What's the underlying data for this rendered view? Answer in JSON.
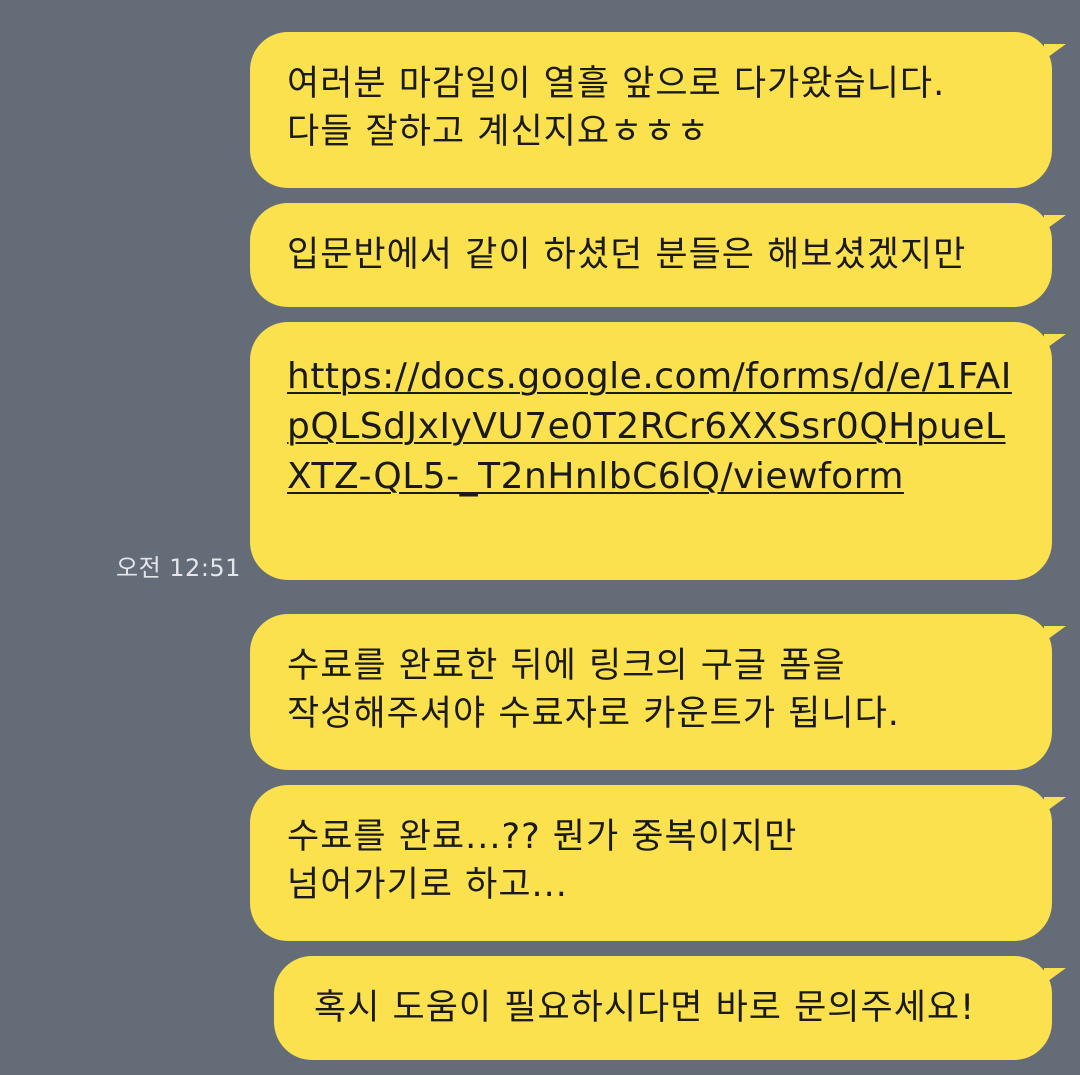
{
  "chat": {
    "background_color": "#646c78",
    "bubble_color": "#fbe14d",
    "timestamp": "오전 12:51",
    "messages": [
      {
        "text": "여러분 마감일이 열흘 앞으로 다가왔습니다.\n다들 잘하고 계신지요ㅎㅎㅎ"
      },
      {
        "text": "입문반에서 같이 하셨던 분들은 해보셨겠지만"
      },
      {
        "link": "https://docs.google.com/forms/d/e/1FAIpQLSdJxIyVU7e0T2RCr6XXSsr0QHpueLXTZ-QL5-_T2nHnlbC6lQ/viewform"
      },
      {
        "text": "수료를 완료한 뒤에 링크의 구글 폼을\n작성해주셔야 수료자로 카운트가 됩니다."
      },
      {
        "text": "수료를 완료...?? 뭔가 중복이지만\n넘어가기로 하고..."
      },
      {
        "text": "혹시 도움이 필요하시다면 바로 문의주세요!"
      }
    ]
  }
}
